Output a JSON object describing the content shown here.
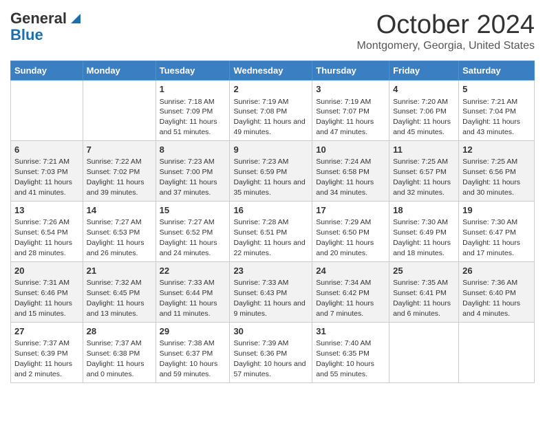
{
  "header": {
    "logo_line1": "General",
    "logo_line2": "Blue",
    "title": "October 2024",
    "subtitle": "Montgomery, Georgia, United States"
  },
  "days_of_week": [
    "Sunday",
    "Monday",
    "Tuesday",
    "Wednesday",
    "Thursday",
    "Friday",
    "Saturday"
  ],
  "weeks": [
    [
      {
        "day": "",
        "info": ""
      },
      {
        "day": "",
        "info": ""
      },
      {
        "day": "1",
        "info": "Sunrise: 7:18 AM\nSunset: 7:09 PM\nDaylight: 11 hours and 51 minutes."
      },
      {
        "day": "2",
        "info": "Sunrise: 7:19 AM\nSunset: 7:08 PM\nDaylight: 11 hours and 49 minutes."
      },
      {
        "day": "3",
        "info": "Sunrise: 7:19 AM\nSunset: 7:07 PM\nDaylight: 11 hours and 47 minutes."
      },
      {
        "day": "4",
        "info": "Sunrise: 7:20 AM\nSunset: 7:06 PM\nDaylight: 11 hours and 45 minutes."
      },
      {
        "day": "5",
        "info": "Sunrise: 7:21 AM\nSunset: 7:04 PM\nDaylight: 11 hours and 43 minutes."
      }
    ],
    [
      {
        "day": "6",
        "info": "Sunrise: 7:21 AM\nSunset: 7:03 PM\nDaylight: 11 hours and 41 minutes."
      },
      {
        "day": "7",
        "info": "Sunrise: 7:22 AM\nSunset: 7:02 PM\nDaylight: 11 hours and 39 minutes."
      },
      {
        "day": "8",
        "info": "Sunrise: 7:23 AM\nSunset: 7:00 PM\nDaylight: 11 hours and 37 minutes."
      },
      {
        "day": "9",
        "info": "Sunrise: 7:23 AM\nSunset: 6:59 PM\nDaylight: 11 hours and 35 minutes."
      },
      {
        "day": "10",
        "info": "Sunrise: 7:24 AM\nSunset: 6:58 PM\nDaylight: 11 hours and 34 minutes."
      },
      {
        "day": "11",
        "info": "Sunrise: 7:25 AM\nSunset: 6:57 PM\nDaylight: 11 hours and 32 minutes."
      },
      {
        "day": "12",
        "info": "Sunrise: 7:25 AM\nSunset: 6:56 PM\nDaylight: 11 hours and 30 minutes."
      }
    ],
    [
      {
        "day": "13",
        "info": "Sunrise: 7:26 AM\nSunset: 6:54 PM\nDaylight: 11 hours and 28 minutes."
      },
      {
        "day": "14",
        "info": "Sunrise: 7:27 AM\nSunset: 6:53 PM\nDaylight: 11 hours and 26 minutes."
      },
      {
        "day": "15",
        "info": "Sunrise: 7:27 AM\nSunset: 6:52 PM\nDaylight: 11 hours and 24 minutes."
      },
      {
        "day": "16",
        "info": "Sunrise: 7:28 AM\nSunset: 6:51 PM\nDaylight: 11 hours and 22 minutes."
      },
      {
        "day": "17",
        "info": "Sunrise: 7:29 AM\nSunset: 6:50 PM\nDaylight: 11 hours and 20 minutes."
      },
      {
        "day": "18",
        "info": "Sunrise: 7:30 AM\nSunset: 6:49 PM\nDaylight: 11 hours and 18 minutes."
      },
      {
        "day": "19",
        "info": "Sunrise: 7:30 AM\nSunset: 6:47 PM\nDaylight: 11 hours and 17 minutes."
      }
    ],
    [
      {
        "day": "20",
        "info": "Sunrise: 7:31 AM\nSunset: 6:46 PM\nDaylight: 11 hours and 15 minutes."
      },
      {
        "day": "21",
        "info": "Sunrise: 7:32 AM\nSunset: 6:45 PM\nDaylight: 11 hours and 13 minutes."
      },
      {
        "day": "22",
        "info": "Sunrise: 7:33 AM\nSunset: 6:44 PM\nDaylight: 11 hours and 11 minutes."
      },
      {
        "day": "23",
        "info": "Sunrise: 7:33 AM\nSunset: 6:43 PM\nDaylight: 11 hours and 9 minutes."
      },
      {
        "day": "24",
        "info": "Sunrise: 7:34 AM\nSunset: 6:42 PM\nDaylight: 11 hours and 7 minutes."
      },
      {
        "day": "25",
        "info": "Sunrise: 7:35 AM\nSunset: 6:41 PM\nDaylight: 11 hours and 6 minutes."
      },
      {
        "day": "26",
        "info": "Sunrise: 7:36 AM\nSunset: 6:40 PM\nDaylight: 11 hours and 4 minutes."
      }
    ],
    [
      {
        "day": "27",
        "info": "Sunrise: 7:37 AM\nSunset: 6:39 PM\nDaylight: 11 hours and 2 minutes."
      },
      {
        "day": "28",
        "info": "Sunrise: 7:37 AM\nSunset: 6:38 PM\nDaylight: 11 hours and 0 minutes."
      },
      {
        "day": "29",
        "info": "Sunrise: 7:38 AM\nSunset: 6:37 PM\nDaylight: 10 hours and 59 minutes."
      },
      {
        "day": "30",
        "info": "Sunrise: 7:39 AM\nSunset: 6:36 PM\nDaylight: 10 hours and 57 minutes."
      },
      {
        "day": "31",
        "info": "Sunrise: 7:40 AM\nSunset: 6:35 PM\nDaylight: 10 hours and 55 minutes."
      },
      {
        "day": "",
        "info": ""
      },
      {
        "day": "",
        "info": ""
      }
    ]
  ]
}
